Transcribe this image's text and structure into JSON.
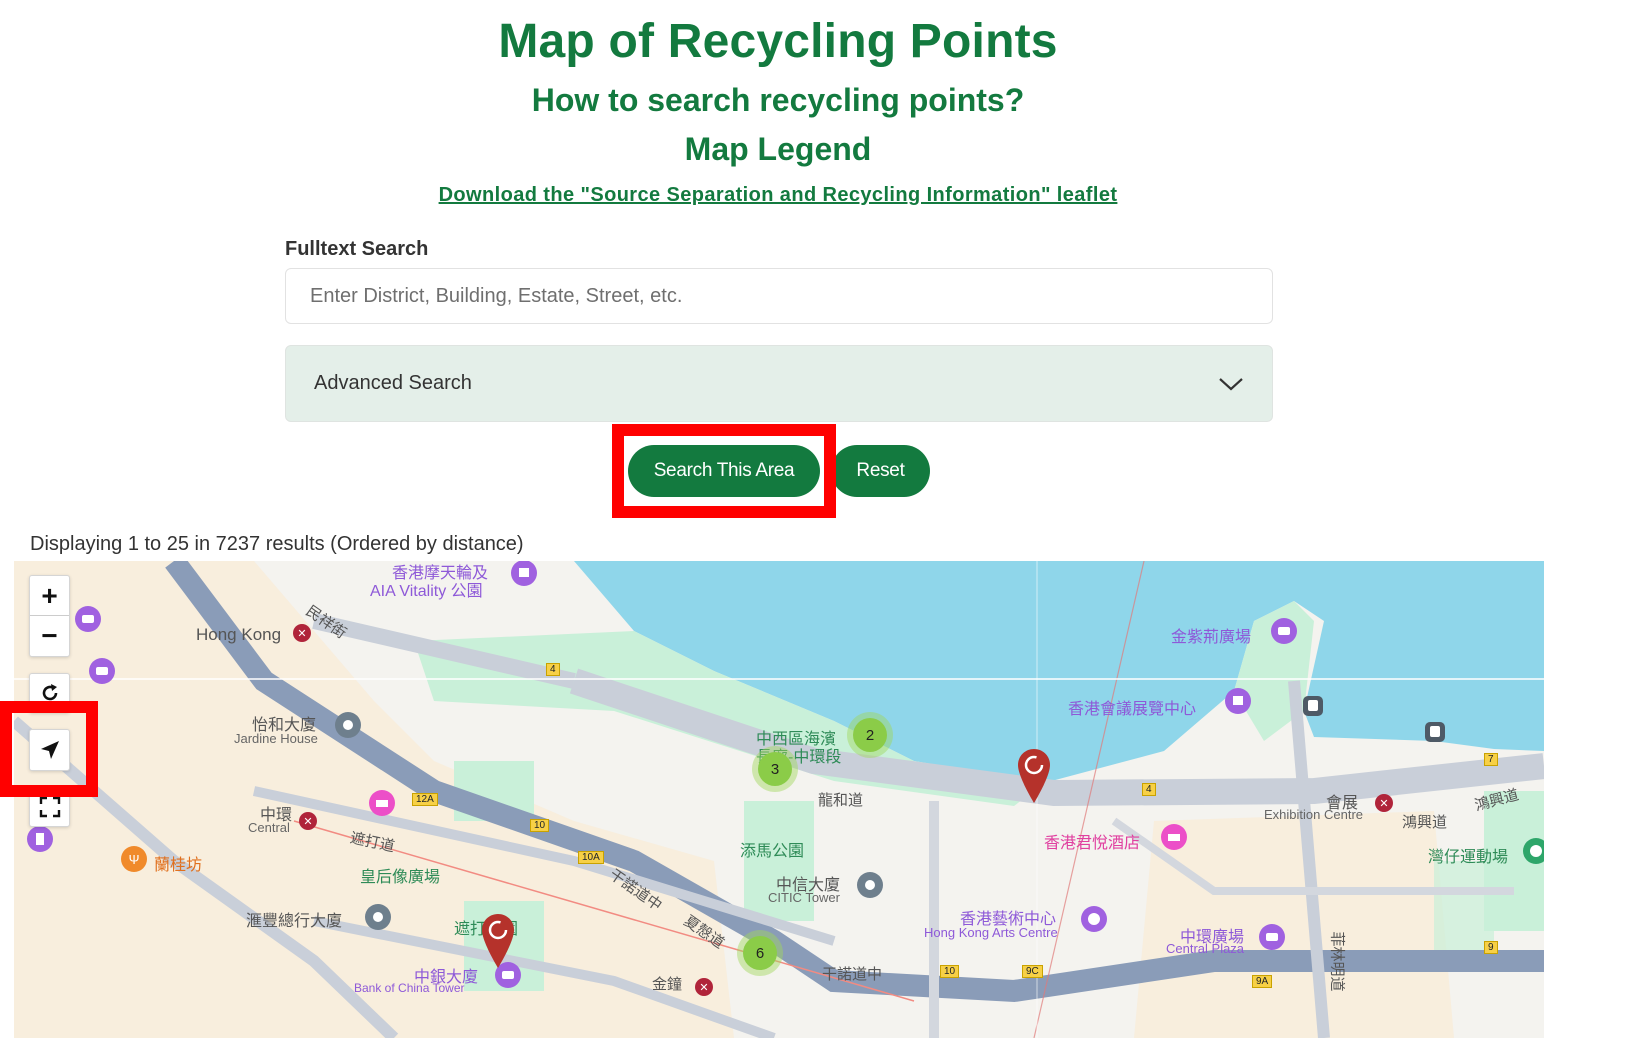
{
  "header": {
    "title": "Map of Recycling Points",
    "how_to_link": "How to search recycling points?",
    "legend_link": "Map Legend",
    "leaflet_link": "Download the \"Source Separation and Recycling Information\" leaflet"
  },
  "search": {
    "label": "Fulltext Search",
    "placeholder": "Enter District, Building, Estate, Street, etc.",
    "value": "",
    "advanced_label": "Advanced Search",
    "search_area_button": "Search This Area",
    "reset_button": "Reset"
  },
  "results": {
    "summary": "Displaying 1 to 25 in 7237 results (Ordered by distance)"
  },
  "map": {
    "controls": {
      "zoom_in": "+",
      "zoom_out": "−"
    },
    "clusters": [
      {
        "count": "2"
      },
      {
        "count": "3"
      },
      {
        "count": "6"
      }
    ],
    "pins": [
      {
        "type": "recycling-point"
      },
      {
        "type": "recycling-point"
      }
    ],
    "labels": {
      "ferris_wheel_zh": "香港摩天輪及",
      "ferris_wheel_en": "AIA Vitality 公園",
      "hong_kong_station": "Hong Kong",
      "man_cheung_st": "民祥街",
      "jardine_zh": "怡和大廈",
      "jardine_en": "Jardine House",
      "central_zh": "中環",
      "central_en": "Central",
      "chater_rd": "遮打道",
      "statue_square": "皇后像廣場",
      "hsbc": "滙豐總行大廈",
      "chater_garden": "遮打花園",
      "boc_zh": "中銀大廈",
      "boc_en": "Bank of China Tower",
      "lkf": "蘭桂坊",
      "waterfront_1": "中西區海濱",
      "waterfront_2": "長廊-中環段",
      "lung_wo_rd": "龍和道",
      "tamar_park": "添馬公園",
      "citic_zh": "中信大廈",
      "citic_en": "CITIC Tower",
      "connaught_rd": "干諾道中",
      "harcourt_rd": "夏慤道",
      "admiralty": "金鐘",
      "golden_bauhinia": "金紫荊廣場",
      "hkcec": "香港會議展覽中心",
      "grand_hyatt": "香港君悅酒店",
      "arts_centre_zh": "香港藝術中心",
      "arts_centre_en": "Hong Kong Arts Centre",
      "exhibition_zh": "會展",
      "exhibition_en": "Exhibition Centre",
      "hung_hing_rd": "鴻興道",
      "wanchai_sports": "灣仔運動場",
      "central_plaza_zh": "中環廣場",
      "central_plaza_en": "Central Plaza",
      "fleming_rd": "菲林明道",
      "route_4": "4",
      "route_12a": "12A",
      "route_10": "10",
      "route_10a": "10A",
      "route_9c": "9C",
      "route_9a": "9A",
      "route_9": "9",
      "route_7": "7"
    }
  }
}
